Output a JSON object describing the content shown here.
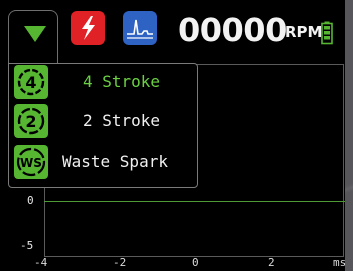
{
  "header": {
    "menu_icon": "triangle-down-icon",
    "ignition_icon": "lightning-bolt-icon",
    "waveform_icon": "pulse-waveform-icon",
    "rpm_value": "00000",
    "rpm_unit": "RPM",
    "battery_icon": "battery-icon",
    "colors": {
      "menu_arrow": "#56b632",
      "ignition_bg": "#e02226",
      "waveform_bg": "#2e63c4",
      "battery": "#56b632"
    }
  },
  "menu": {
    "items": [
      {
        "badge": "4",
        "label": "4 Stroke",
        "selected": true
      },
      {
        "badge": "2",
        "label": "2 Stroke",
        "selected": false
      },
      {
        "badge": "WS",
        "label": "Waste Spark",
        "selected": false
      }
    ],
    "colors": {
      "badge": "#56b632",
      "selected_text": "#6bd143",
      "text": "#f0f0f0"
    }
  },
  "graph": {
    "y_labels": [
      "0",
      "-5"
    ],
    "x_labels": [
      "-4",
      "-2",
      "0",
      "2",
      "ms"
    ],
    "colors": {
      "trace": "#4e9a37",
      "frame": "#5a5a5a"
    }
  }
}
